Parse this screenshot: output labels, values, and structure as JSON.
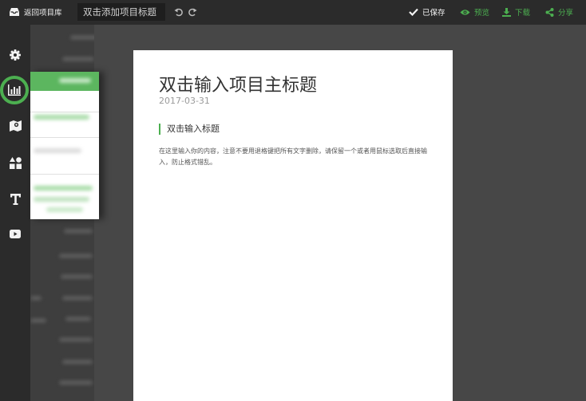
{
  "topbar": {
    "back_label": "返回项目库",
    "title_input_value": "双击添加项目标题",
    "saved_label": "已保存",
    "preview_label": "预览",
    "download_label": "下载",
    "share_label": "分享"
  },
  "sidebar": {
    "items": [
      {
        "icon": "gear-icon"
      },
      {
        "icon": "bar-chart-icon",
        "active": true
      },
      {
        "icon": "map-icon"
      },
      {
        "icon": "shapes-icon"
      },
      {
        "icon": "text-icon"
      },
      {
        "icon": "video-icon"
      }
    ]
  },
  "document": {
    "title": "双击输入项目主标题",
    "date": "2017-03-31",
    "section_title": "双击输入标题",
    "body": "在这里输入你的内容，注意不要用退格键把所有文字删除，请保留一个或者用鼠标选取后直接输入，防止格式错乱。"
  },
  "colors": {
    "accent": "#4caf50",
    "topbar_bg": "#2b2b2b",
    "canvas_bg": "#474747",
    "page_bg": "#ffffff"
  }
}
